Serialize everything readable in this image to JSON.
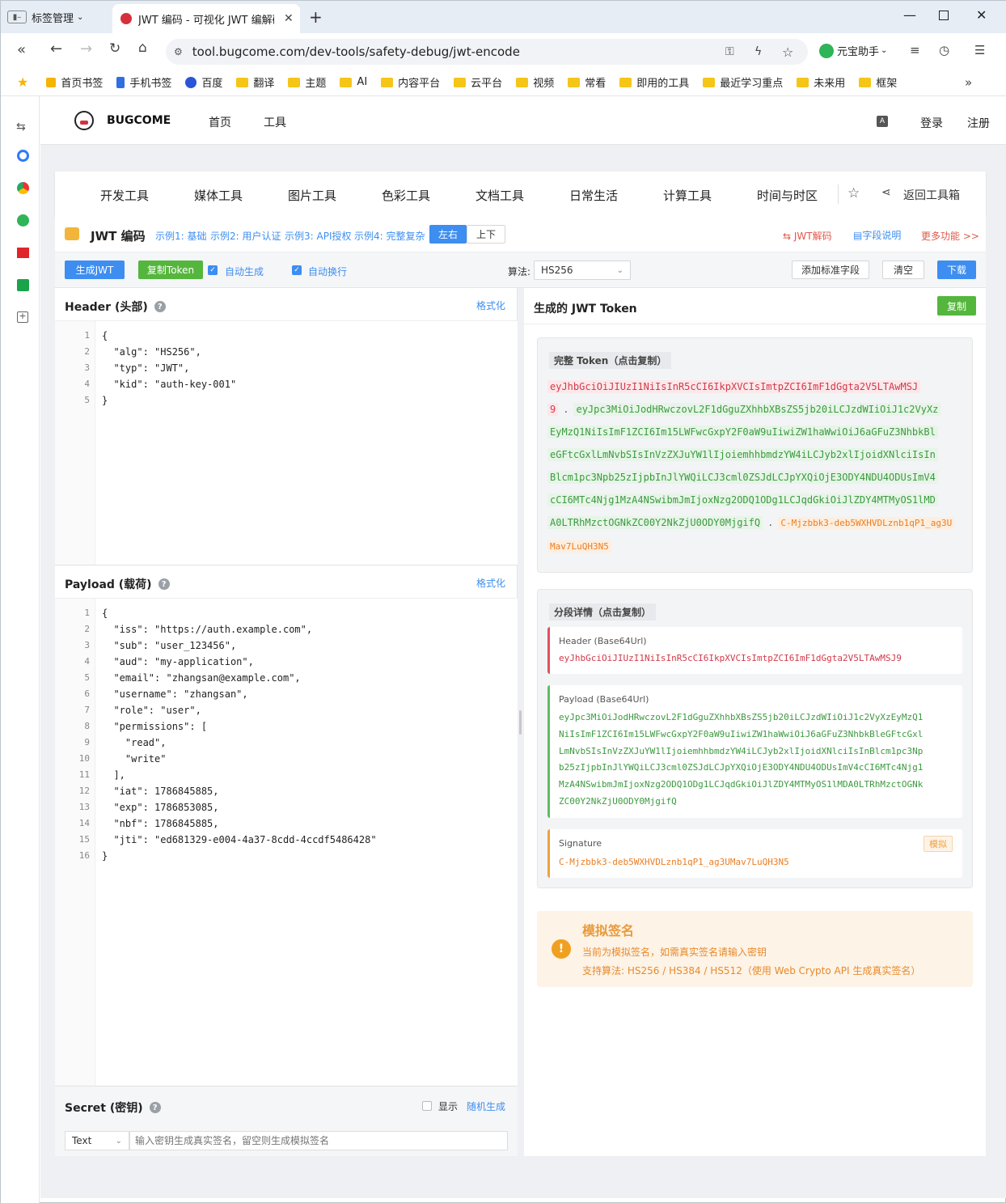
{
  "browser": {
    "tab_group": "标签管理",
    "tab_title": "JWT 编码 - 可视化 JWT 编解码",
    "url": "tool.bugcome.com/dev-tools/safety-debug/jwt-encode",
    "assistant": "元宝助手"
  },
  "bookmarks": [
    "首页书签",
    "手机书签",
    "百度",
    "翻译",
    "主题",
    "AI",
    "内容平台",
    "云平台",
    "视频",
    "常看",
    "即用的工具",
    "最近学习重点",
    "未来用",
    "框架"
  ],
  "site": {
    "logo": "BUGCOME",
    "nav": [
      "首页",
      "工具"
    ],
    "login": "登录",
    "register": "注册"
  },
  "categories": [
    "开发工具",
    "媒体工具",
    "图片工具",
    "色彩工具",
    "文档工具",
    "日常生活",
    "计算工具",
    "时间与时区"
  ],
  "back_to_toolbox": "返回工具箱",
  "tool": {
    "title": "JWT 编码",
    "examples": [
      "示例1: 基础",
      "示例2: 用户认证",
      "示例3: API授权",
      "示例4: 完整复杂"
    ],
    "layout_lr": "左右",
    "layout_tb": "上下",
    "jwt_decode": "JWT解码",
    "field_help": "字段说明",
    "more": "更多功能 >>"
  },
  "toolbar": {
    "generate": "生成JWT",
    "copy_token": "复制Token",
    "auto_generate": "自动生成",
    "auto_wrap": "自动换行",
    "algo_label": "算法:",
    "algo_value": "HS256",
    "add_std": "添加标准字段",
    "clear": "清空",
    "download": "下载"
  },
  "header_section": {
    "title": "Header (头部)",
    "format": "格式化",
    "lines": [
      "{",
      "  \"alg\": \"HS256\",",
      "  \"typ\": \"JWT\",",
      "  \"kid\": \"auth-key-001\"",
      "}"
    ]
  },
  "payload_section": {
    "title": "Payload (载荷)",
    "format": "格式化",
    "lines": [
      "{",
      "  \"iss\": \"https://auth.example.com\",",
      "  \"sub\": \"user_123456\",",
      "  \"aud\": \"my-application\",",
      "  \"email\": \"zhangsan@example.com\",",
      "  \"username\": \"zhangsan\",",
      "  \"role\": \"user\",",
      "  \"permissions\": [",
      "    \"read\",",
      "    \"write\"",
      "  ],",
      "  \"iat\": 1786845885,",
      "  \"exp\": 1786853085,",
      "  \"nbf\": 1786845885,",
      "  \"jti\": \"ed681329-e004-4a37-8cdd-4ccdf5486428\"",
      "}"
    ]
  },
  "secret": {
    "title": "Secret (密钥)",
    "show": "显示",
    "random": "随机生成",
    "type": "Text",
    "placeholder": "输入密钥生成真实签名，留空则生成模拟签名"
  },
  "result": {
    "title": "生成的 JWT Token",
    "copy": "复制",
    "full_title": "完整 Token（点击复制）",
    "tok_lines": [
      {
        "h": "eyJhbGciOiJIUzI1NiIsInR5cCI6IkpXVCIsImtpZCI6ImF1dGgta2V5LTAwMSJ"
      },
      {
        "h": "9",
        "dot": ".",
        "p": "eyJpc3MiOiJodHRwczovL2F1dGguZXhhbXBsZS5jb20iLCJzdWIiOiJ1c2VyXz"
      },
      {
        "p": "EyMzQ1NiIsImF1ZCI6Im15LWFwcGxpY2F0aW9uIiwiZW1haWwiOiJ6aGFuZ3NhbkBl"
      },
      {
        "p": "eGFtcGxlLmNvbSIsInVzZXJuYW1lIjoiemhhbmdzYW4iLCJyb2xlIjoidXNlciIsIn"
      },
      {
        "p": "Blcm1pc3Npb25zIjpbInJlYWQiLCJ3cml0ZSJdLCJpYXQiOjE3ODY4NDU4ODUsImV4"
      },
      {
        "p": "cCI6MTc4Njg1MzA4NSwibmJmIjoxNzg2ODQ1ODg1LCJqdGkiOiJlZDY4MTMyOS1lMD"
      },
      {
        "p": "A0LTRhMzctOGNkZC00Y2NkZjU0ODY0MjgifQ",
        "dot": ".",
        "s": "C-Mjzbbk3-deb5WXHVDLznb1qP1_ag3U"
      },
      {
        "s": "Mav7LuQH3N5"
      }
    ],
    "seg_title": "分段详情（点击复制）",
    "seg_header_label": "Header (Base64Url)",
    "seg_header_value": "eyJhbGciOiJIUzI1NiIsInR5cCI6IkpXVCIsImtpZCI6ImF1dGgta2V5LTAwMSJ9",
    "seg_payload_label": "Payload (Base64Url)",
    "seg_payload_lines": [
      "eyJpc3MiOiJodHRwczovL2F1dGguZXhhbXBsZS5jb20iLCJzdWIiOiJ1c2VyXzEyMzQ1",
      "NiIsImF1ZCI6Im15LWFwcGxpY2F0aW9uIiwiZW1haWwiOiJ6aGFuZ3NhbkBleGFtcGxl",
      "LmNvbSIsInVzZXJuYW1lIjoiemhhbmdzYW4iLCJyb2xlIjoidXNlciIsInBlcm1pc3Np",
      "b25zIjpbInJlYWQiLCJ3cml0ZSJdLCJpYXQiOjE3ODY4NDU4ODUsImV4cCI6MTc4Njg1",
      "MzA4NSwibmJmIjoxNzg2ODQ1ODg1LCJqdGkiOiJlZDY4MTMyOS1lMDA0LTRhMzctOGNk",
      "ZC00Y2NkZjU0ODY0MjgifQ"
    ],
    "seg_sig_label": "Signature",
    "seg_sig_badge": "模拟",
    "seg_sig_value": "C-Mjzbbk3-deb5WXHVDLznb1qP1_ag3UMav7LuQH3N5",
    "warn_title": "模拟签名",
    "warn_line1": "当前为模拟签名，如需真实签名请输入密钥",
    "warn_line2": "支持算法: HS256 / HS384 / HS512（使用 Web Crypto API 生成真实签名）"
  }
}
